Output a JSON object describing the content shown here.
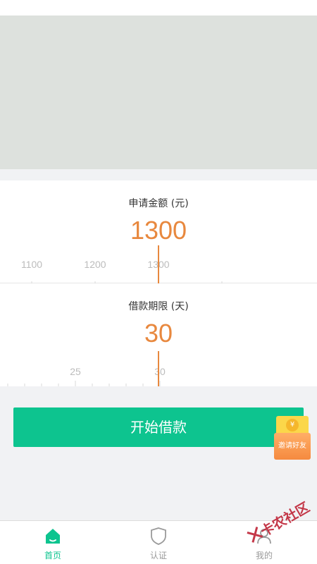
{
  "amount": {
    "title": "申请金额 (元)",
    "value": "1300",
    "ticks": [
      "1100",
      "1200",
      "1300"
    ]
  },
  "term": {
    "title": "借款期限 (天)",
    "value": "30",
    "ticks": [
      "25",
      "30"
    ]
  },
  "start_button": {
    "label": "开始借款"
  },
  "invite_badge": {
    "label": "邀请好友",
    "coupon_symbol": "¥"
  },
  "tabbar": {
    "items": [
      {
        "label": "首页",
        "icon": "home-icon",
        "active": true
      },
      {
        "label": "认证",
        "icon": "shield-icon",
        "active": false
      },
      {
        "label": "我的",
        "icon": "profile-icon",
        "active": false
      }
    ]
  },
  "watermark": {
    "text": "卡农社区"
  },
  "colors": {
    "accent": "#0dc48f",
    "value": "#e8883e",
    "banner": "#dde1dd",
    "tab_inactive": "#9a9a9a"
  }
}
